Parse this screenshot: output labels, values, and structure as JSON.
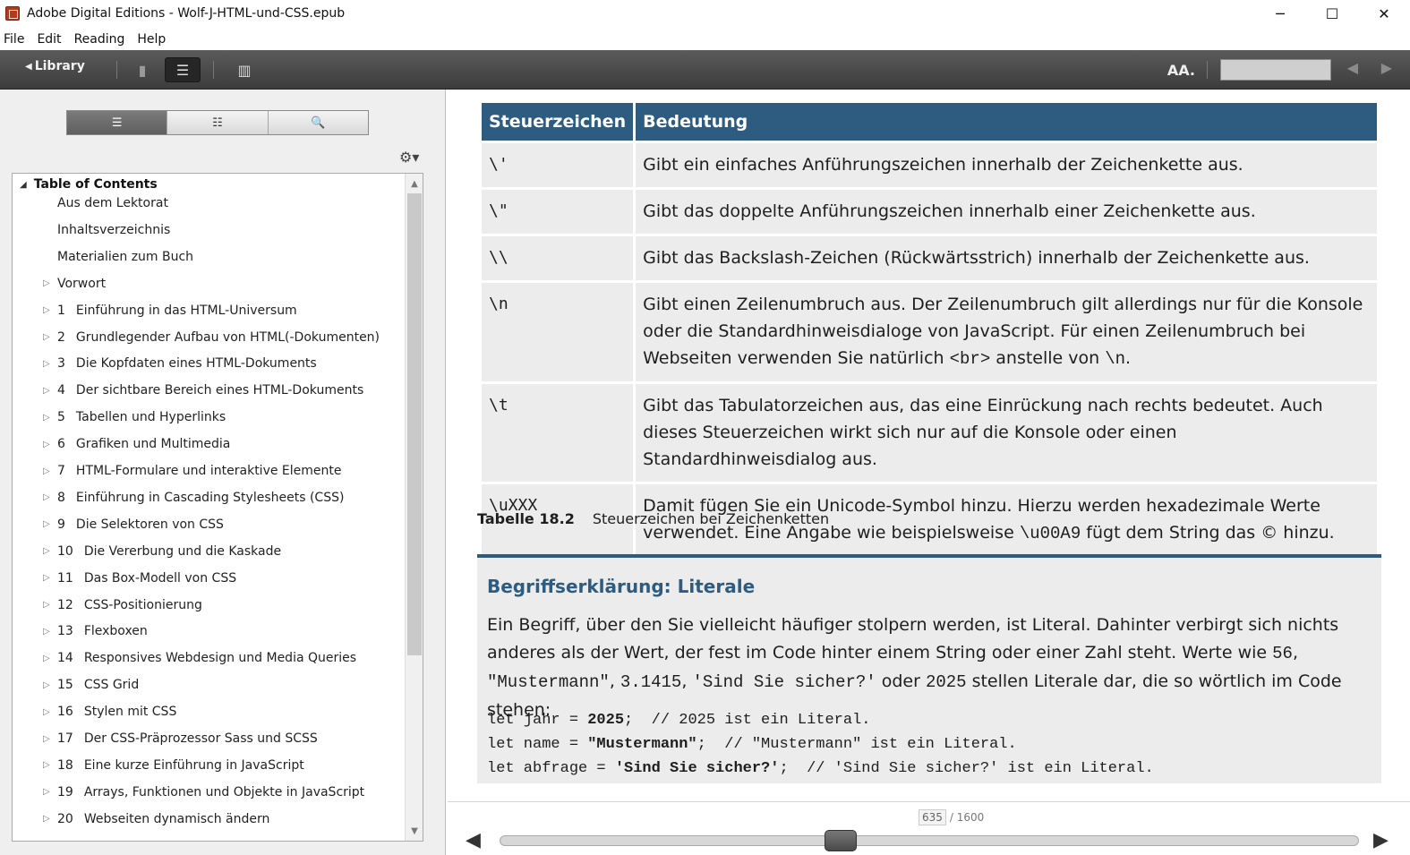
{
  "window": {
    "title": "Adobe Digital Editions - Wolf-J-HTML-und-CSS.epub",
    "minimize": "─",
    "maximize": "☐",
    "close": "✕"
  },
  "menu": [
    "File",
    "Edit",
    "Reading",
    "Help"
  ],
  "toolbar": {
    "library_label": "Library",
    "library_arrow": "◀",
    "bookmark_icon": "▮",
    "toc_icon": "☰",
    "stats_icon": "▥",
    "font_label": "AA.",
    "prev": "◀",
    "next": "▶",
    "page_input": ""
  },
  "panel": {
    "tabs": [
      {
        "name": "toc-tab",
        "glyph": "☰"
      },
      {
        "name": "bookmarks-tab",
        "glyph": "☷"
      },
      {
        "name": "search-tab",
        "glyph": "🔍"
      }
    ],
    "gear": "⚙▾",
    "toc_root": "Table of Contents",
    "toc_root_arrow": "◢",
    "toc_items": [
      {
        "num": "",
        "label": "Aus dem Lektorat",
        "expandable": false
      },
      {
        "num": "",
        "label": "Inhaltsverzeichnis",
        "expandable": false
      },
      {
        "num": "",
        "label": "Materialien zum Buch",
        "expandable": false
      },
      {
        "num": "",
        "label": "Vorwort",
        "expandable": true
      },
      {
        "num": "1",
        "label": "Einführung in das HTML-Universum",
        "expandable": true
      },
      {
        "num": "2",
        "label": "Grundlegender Aufbau von HTML(-Dokumenten)",
        "expandable": true
      },
      {
        "num": "3",
        "label": "Die Kopfdaten eines HTML-Dokuments",
        "expandable": true
      },
      {
        "num": "4",
        "label": "Der sichtbare Bereich eines HTML-Dokuments",
        "expandable": true
      },
      {
        "num": "5",
        "label": "Tabellen und Hyperlinks",
        "expandable": true
      },
      {
        "num": "6",
        "label": "Grafiken und Multimedia",
        "expandable": true
      },
      {
        "num": "7",
        "label": "HTML-Formulare und interaktive Elemente",
        "expandable": true
      },
      {
        "num": "8",
        "label": "Einführung in Cascading Stylesheets (CSS)",
        "expandable": true
      },
      {
        "num": "9",
        "label": "Die Selektoren von CSS",
        "expandable": true
      },
      {
        "num": "10",
        "label": "Die Vererbung und die Kaskade",
        "expandable": true
      },
      {
        "num": "11",
        "label": "Das Box-Modell von CSS",
        "expandable": true
      },
      {
        "num": "12",
        "label": "CSS-Positionierung",
        "expandable": true
      },
      {
        "num": "13",
        "label": "Flexboxen",
        "expandable": true
      },
      {
        "num": "14",
        "label": "Responsives Webdesign und Media Queries",
        "expandable": true
      },
      {
        "num": "15",
        "label": "CSS Grid",
        "expandable": true
      },
      {
        "num": "16",
        "label": "Stylen mit CSS",
        "expandable": true
      },
      {
        "num": "17",
        "label": "Der CSS-Präprozessor Sass und SCSS",
        "expandable": true
      },
      {
        "num": "18",
        "label": "Eine kurze Einführung in JavaScript",
        "expandable": true
      },
      {
        "num": "19",
        "label": "Arrays, Funktionen und Objekte in JavaScript",
        "expandable": true
      },
      {
        "num": "20",
        "label": "Webseiten dynamisch ändern",
        "expandable": true
      }
    ]
  },
  "content": {
    "table": {
      "headers": [
        "Steuerzeichen",
        "Bedeutung"
      ],
      "rows": [
        {
          "code": "\\'",
          "desc": "Gibt ein einfaches Anführungszeichen innerhalb der Zeichenkette aus."
        },
        {
          "code": "\\\"",
          "desc": "Gibt das doppelte Anführungszeichen innerhalb einer Zeichenkette aus."
        },
        {
          "code": "\\\\",
          "desc": "Gibt das Backslash-Zeichen (Rückwärtsstrich) innerhalb der Zeichenkette aus."
        },
        {
          "code": "\\n",
          "desc_parts": [
            "Gibt einen Zeilenumbruch aus. Der Zeilenumbruch gilt allerdings nur für die Konsole oder die Standardhinweisdialoge von JavaScript. Für einen Zeilenumbruch bei Webseiten verwenden Sie natürlich ",
            "<br>",
            " anstelle von ",
            "\\n",
            "."
          ]
        },
        {
          "code": "\\t",
          "desc": "Gibt das Tabulatorzeichen aus, das eine Einrückung nach rechts bedeutet. Auch dieses Steuerzeichen wirkt sich nur auf die Konsole oder einen Standardhinweisdialog aus."
        },
        {
          "code": "\\uXXX",
          "desc_parts": [
            "Damit fügen Sie ein Unicode-Symbol hinzu. Hierzu werden hexadezimale Werte verwendet. Eine Angabe wie beispielsweise ",
            "\\u00A9",
            " fügt dem String das © hinzu."
          ]
        }
      ]
    },
    "caption_label": "Tabelle 18.2",
    "caption_text": "Steuerzeichen bei Zeichenketten",
    "box": {
      "title": "Begriffserklärung: Literale",
      "text_parts": [
        "Ein Begriff, über den Sie vielleicht häufiger stolpern werden, ist Literal. Dahinter verbirgt sich nichts anderes als der Wert, der fest im Code hinter einem String oder einer Zahl steht. Werte wie ",
        "56",
        ", ",
        "\"Mustermann\"",
        ", ",
        "3.1415",
        ", ",
        "'Sind Sie sicher?'",
        " oder ",
        "2025",
        " stellen Literale dar, die so wörtlich im Code stehen:"
      ],
      "code_lines": [
        {
          "pre": "let jahr = ",
          "bold": "2025",
          "post": ";  // 2025 ist ein Literal."
        },
        {
          "pre": "let name = ",
          "bold": "\"Mustermann\"",
          "post": ";  // \"Mustermann\" ist ein Literal."
        },
        {
          "pre": "let abfrage = ",
          "bold": "'Sind Sie sicher?'",
          "post": ";  // 'Sind Sie sicher?' ist ein Literal."
        }
      ]
    }
  },
  "footer": {
    "current_page": "635",
    "total_pages": "/ 1600",
    "progress": 0.397,
    "prev": "◀",
    "next": "▶"
  }
}
